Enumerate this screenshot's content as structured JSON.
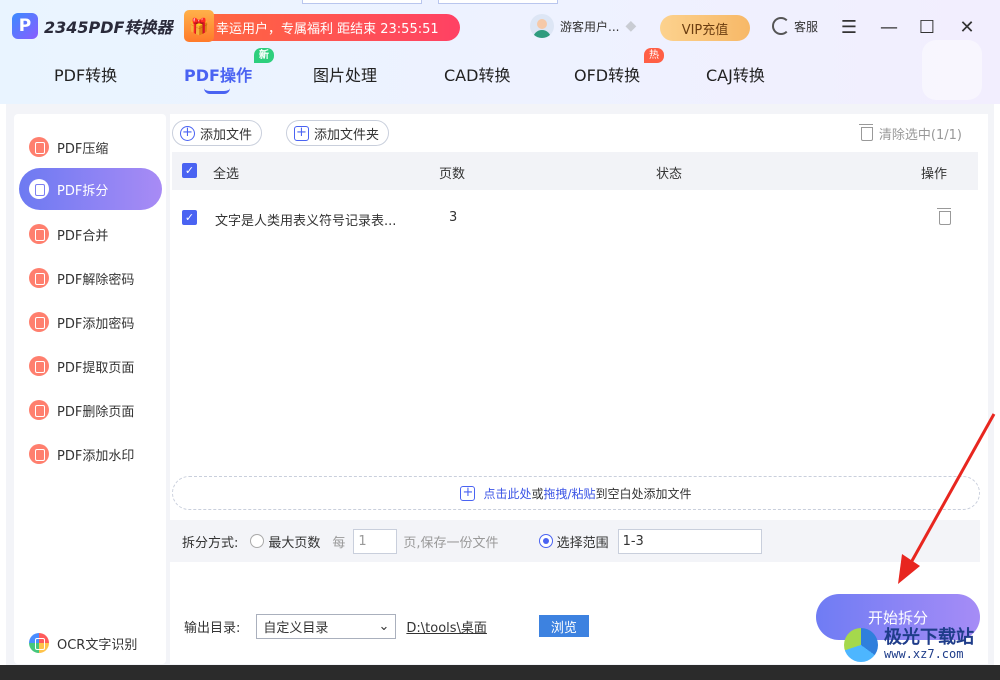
{
  "app": {
    "logo_text": "2345PDF转换器",
    "logo_mark": "P"
  },
  "promo": {
    "text": "幸运用户，专属福利 距结束 23:55:51"
  },
  "user": {
    "name": "游客用户..."
  },
  "vip_label": "VIP充值",
  "service_label": "客服",
  "nav": {
    "items": [
      {
        "label": "PDF转换"
      },
      {
        "label": "PDF操作",
        "badge": "新"
      },
      {
        "label": "图片处理"
      },
      {
        "label": "CAD转换"
      },
      {
        "label": "OFD转换",
        "badge": "热"
      },
      {
        "label": "CAJ转换"
      }
    ],
    "active_index": 1
  },
  "sidebar": {
    "items": [
      {
        "label": "PDF压缩",
        "icon": "compress-icon"
      },
      {
        "label": "PDF拆分",
        "icon": "split-icon"
      },
      {
        "label": "PDF合并",
        "icon": "merge-icon"
      },
      {
        "label": "PDF解除密码",
        "icon": "unlock-icon"
      },
      {
        "label": "PDF添加密码",
        "icon": "lock-icon"
      },
      {
        "label": "PDF提取页面",
        "icon": "extract-icon"
      },
      {
        "label": "PDF删除页面",
        "icon": "delete-page-icon"
      },
      {
        "label": "PDF添加水印",
        "icon": "watermark-icon"
      }
    ],
    "active_index": 1,
    "ocr_label": "OCR文字识别",
    "ocr_badge": "OCR"
  },
  "toolbar": {
    "add_file": "添加文件",
    "add_folder": "添加文件夹",
    "clear_selected": "清除选中(1/1)"
  },
  "table": {
    "headers": {
      "select_all": "全选",
      "pages": "页数",
      "status": "状态",
      "actions": "操作"
    },
    "rows": [
      {
        "name": "文字是人类用表义符号记录表...",
        "pages": "3",
        "status": "",
        "checked": true
      }
    ]
  },
  "dropzone": {
    "click_here": "点击此处",
    "or": "或",
    "drag_paste": "拖拽/粘贴",
    "rest": "到空白处添加文件"
  },
  "split": {
    "label": "拆分方式:",
    "max_pages_label": "最大页数",
    "every_label": "每",
    "every_value": "1",
    "every_suffix": "页,保存一份文件",
    "range_label": "选择范围",
    "range_value": "1-3",
    "selected": "range"
  },
  "output": {
    "label": "输出目录:",
    "dir_option": "自定义目录",
    "path": "D:\\tools\\桌面",
    "browse": "浏览"
  },
  "start_button": "开始拆分",
  "site_watermark": {
    "name": "极光下载站",
    "url": "www.xz7.com"
  },
  "colors": {
    "accent": "#4a63f2",
    "promo": "#ff4164",
    "vip": "#f7b867",
    "arrow": "#e8261f"
  }
}
